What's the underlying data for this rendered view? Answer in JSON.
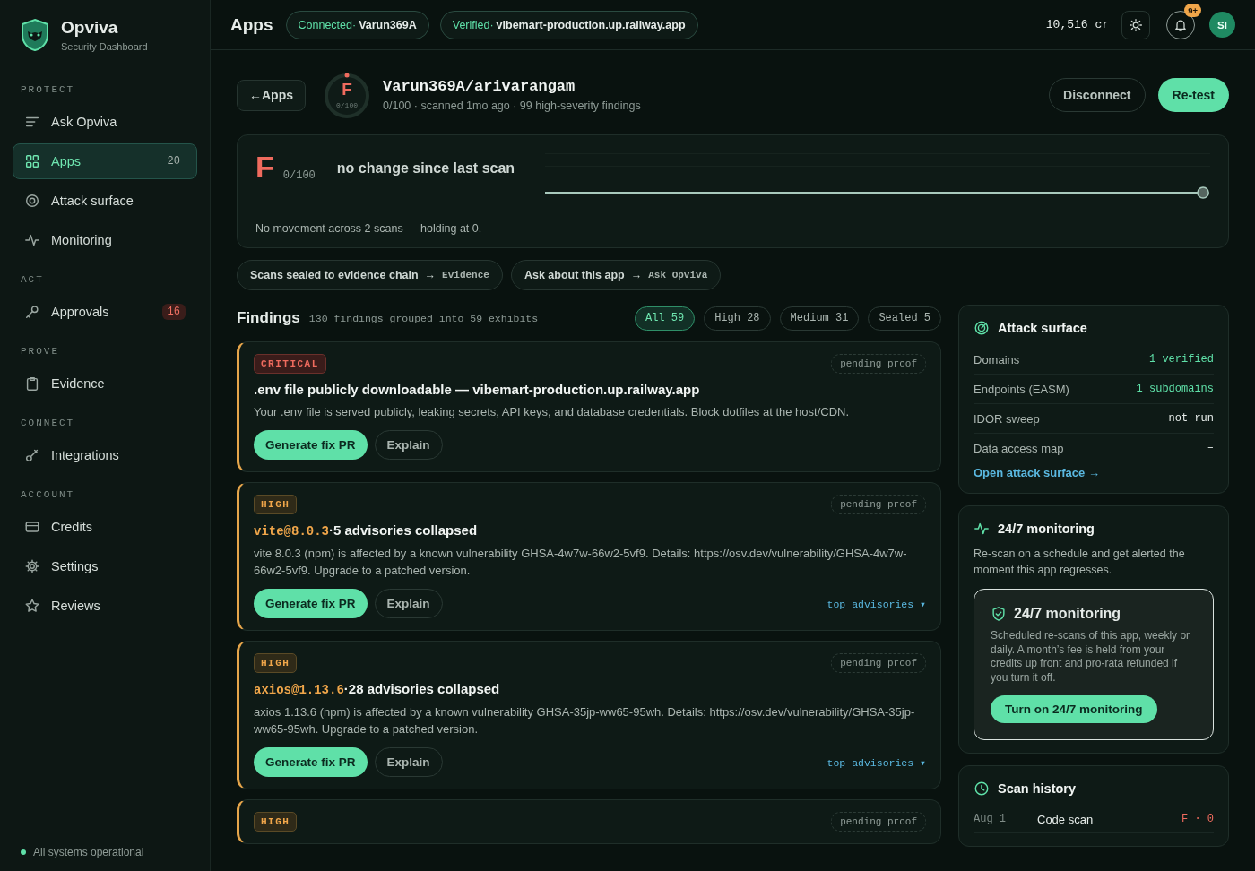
{
  "brand": {
    "name": "Opviva",
    "subtitle": "Security Dashboard"
  },
  "sidebar": {
    "sections": [
      {
        "heading": "PROTECT",
        "items": [
          {
            "label": "Ask Opviva",
            "selected": false
          },
          {
            "label": "Apps",
            "count": "20",
            "count_alert": false,
            "selected": true
          },
          {
            "label": "Attack surface",
            "selected": false
          },
          {
            "label": "Monitoring",
            "selected": false
          }
        ]
      },
      {
        "heading": "ACT",
        "items": [
          {
            "label": "Approvals",
            "count": "16",
            "count_alert": true,
            "selected": false
          }
        ]
      },
      {
        "heading": "PROVE",
        "items": [
          {
            "label": "Evidence",
            "selected": false
          }
        ]
      },
      {
        "heading": "CONNECT",
        "items": [
          {
            "label": "Integrations",
            "selected": false
          }
        ]
      },
      {
        "heading": "ACCOUNT",
        "items": [
          {
            "label": "Credits",
            "selected": false
          },
          {
            "label": "Settings",
            "selected": false
          },
          {
            "label": "Reviews",
            "selected": false
          }
        ]
      }
    ],
    "status": "All systems operational"
  },
  "topbar": {
    "title": "Apps",
    "chips": [
      {
        "label": "Connected·",
        "value": "Varun369A"
      },
      {
        "label": "Verified·",
        "value": "vibemart-production.up.railway.app"
      }
    ],
    "credits": "10,516 cr",
    "notifications": "9+",
    "avatar": "SI"
  },
  "app": {
    "back_arrow": "←",
    "back_label": "Apps",
    "grade": "F",
    "score": "0/100",
    "name": "Varun369A/arivarangam",
    "meta": "0/100 · scanned 1mo ago · 99 high-severity findings",
    "buttons": [
      {
        "label": "Disconnect",
        "kind": "secondary"
      },
      {
        "label": "Re-test",
        "kind": "primary"
      }
    ]
  },
  "trend": {
    "grade": "F",
    "score": "0/100",
    "headline": "no change since last scan",
    "note": "No movement across 2 scans — holding at 0."
  },
  "links": [
    {
      "text": "Scans sealed to evidence chain",
      "arrow": "→",
      "target": "Evidence"
    },
    {
      "text": "Ask about this app",
      "arrow": "→",
      "target": "Ask Opviva"
    }
  ],
  "findings": {
    "title": "Findings",
    "summary": "130 findings grouped into 59 exhibits",
    "filters": [
      {
        "label": "All 59",
        "selected": true
      },
      {
        "label": "High 28",
        "selected": false
      },
      {
        "label": "Medium 31",
        "selected": false
      },
      {
        "label": "Sealed 5",
        "selected": false
      }
    ],
    "items": [
      {
        "severity": "CRITICAL",
        "kind": "critical",
        "status": "pending proof",
        "title": ".env file publicly downloadable — vibemart-production.up.railway.app",
        "description": "Your .env file is served publicly, leaking secrets, API keys, and database credentials. Block dotfiles at the host/CDN.",
        "actions": [
          "Generate fix PR",
          "Explain"
        ]
      },
      {
        "severity": "HIGH",
        "kind": "high",
        "status": "pending proof",
        "package": "vite@8.0.3",
        "title": "·5 advisories collapsed",
        "description": "vite 8.0.3 (npm) is affected by a known vulnerability GHSA-4w7w-66w2-5vf9. Details: https://osv.dev/vulnerability/GHSA-4w7w-66w2-5vf9. Upgrade to a patched version.",
        "actions": [
          "Generate fix PR",
          "Explain"
        ],
        "more": "top advisories ▾"
      },
      {
        "severity": "HIGH",
        "kind": "high",
        "status": "pending proof",
        "package": "axios@1.13.6",
        "title": "·28 advisories collapsed",
        "description": "axios 1.13.6 (npm) is affected by a known vulnerability GHSA-35jp-ww65-95wh. Details: https://osv.dev/vulnerability/GHSA-35jp-ww65-95wh. Upgrade to a patched version.",
        "actions": [
          "Generate fix PR",
          "Explain"
        ],
        "more": "top advisories ▾"
      },
      {
        "severity": "HIGH",
        "kind": "high",
        "status": "pending proof"
      }
    ]
  },
  "attack_surface": {
    "title": "Attack surface",
    "rows": [
      {
        "label": "Domains",
        "value": "1 verified",
        "highlighted": true
      },
      {
        "label": "Endpoints (EASM)",
        "value": "1 subdomains",
        "highlighted": true
      },
      {
        "label": "IDOR sweep",
        "value": "not run",
        "highlighted": false
      },
      {
        "label": "Data access map",
        "value": "–",
        "highlighted": false
      }
    ],
    "link": "Open attack surface →"
  },
  "monitoring": {
    "title": "24/7 monitoring",
    "description": "Re-scan on a schedule and get alerted the moment this app regresses.",
    "card": {
      "title": "24/7 monitoring",
      "description": "Scheduled re-scans of this app, weekly or daily. A month’s fee is held from your credits up front and pro-rata refunded if you turn it off.",
      "button": "Turn on 24/7 monitoring"
    }
  },
  "scan_history": {
    "title": "Scan history",
    "rows": [
      {
        "date": "Aug 1",
        "type": "Code scan",
        "result": "F · 0"
      }
    ]
  }
}
